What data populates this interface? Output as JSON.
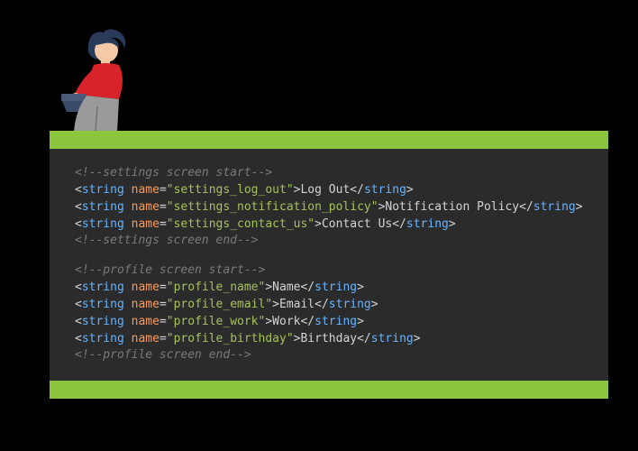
{
  "code": {
    "section1": {
      "comment_start": "<!--settings screen start-->",
      "comment_end": "<!--settings screen end-->",
      "lines": [
        {
          "name": "\"settings_log_out\"",
          "value": "Log Out"
        },
        {
          "name": "\"settings_notification_policy\"",
          "value": "Notification Policy"
        },
        {
          "name": "\"settings_contact_us\"",
          "value": "Contact Us"
        }
      ]
    },
    "section2": {
      "comment_start": "<!--profile screen start-->",
      "comment_end": "<!--profile screen end-->",
      "lines": [
        {
          "name": "\"profile_name\"",
          "value": "Name"
        },
        {
          "name": "\"profile_email\"",
          "value": "Email"
        },
        {
          "name": "\"profile_work\"",
          "value": "Work"
        },
        {
          "name": "\"profile_birthday\"",
          "value": "Birthday"
        }
      ]
    },
    "tokens": {
      "open": "<",
      "close": ">",
      "end_open": "</",
      "tag": "string",
      "attr": "name",
      "eq": "="
    }
  }
}
